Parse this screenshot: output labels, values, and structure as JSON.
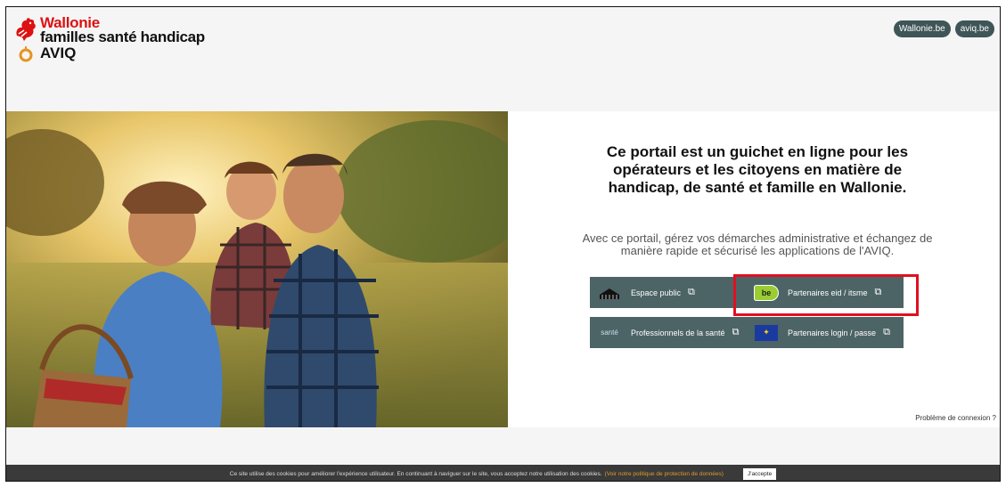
{
  "header": {
    "logo_line1": "Wallonie",
    "logo_line2": "familles santé handicap",
    "logo_line3": "AVIQ",
    "links": [
      "Wallonie.be",
      "aviq.be"
    ]
  },
  "main": {
    "title": "Ce portail est un guichet en ligne pour les opérateurs et les citoyens en matière de handicap, de santé et famille en Wallonie.",
    "subtitle": "Avec ce portail, gérez vos démarches administrative et échangez de manière rapide et sécurisé les applications de l'AVIQ.",
    "tiles": [
      {
        "label": "Espace public",
        "icon": "building-icon"
      },
      {
        "label": "Partenaires eid / itsme",
        "icon": "beid-icon",
        "icon_text": "be"
      },
      {
        "label": "Professionnels de la santé",
        "icon": "sante-icon",
        "icon_text": "santé"
      },
      {
        "label": "Partenaires login / passe",
        "icon": "eu-flag-icon"
      }
    ],
    "problem_link": "Problème de connexion ?"
  },
  "cookie_bar": {
    "text": "Ce site utilise des cookies pour améliorer l'expérience utilisateur. En continuant à naviguer sur le site, vous acceptez notre utilisation des cookies.",
    "link": "(Voir notre politique de protection de données)",
    "accept": "J'accepte"
  },
  "colors": {
    "tile": "#4d6466",
    "highlight": "#e01020",
    "accent_red": "#dd1111",
    "pill": "#3f5557"
  }
}
